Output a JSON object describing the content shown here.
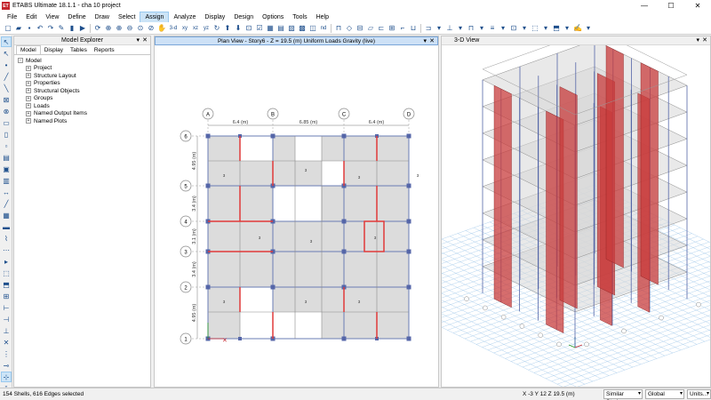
{
  "window": {
    "title": "ETABS Ultimate 18.1.1 - cha 10 project",
    "app_icon_text": "ET",
    "minimize": "—",
    "maximize": "☐",
    "close": "✕"
  },
  "menu": [
    "File",
    "Edit",
    "View",
    "Define",
    "Draw",
    "Select",
    "Assign",
    "Analyze",
    "Display",
    "Design",
    "Options",
    "Tools",
    "Help"
  ],
  "menu_active": "Assign",
  "toolbar": {
    "threed_label": "3-d",
    "xy_label": "xy",
    "xz_label": "xz",
    "yz_label": "yz",
    "nd_label": "nd"
  },
  "explorer": {
    "title": "Model Explorer",
    "tabs": [
      "Model",
      "Display",
      "Tables",
      "Reports"
    ],
    "active_tab": "Model",
    "root": "Model",
    "items": [
      "Project",
      "Structure Layout",
      "Properties",
      "Structural Objects",
      "Groups",
      "Loads",
      "Named Output Items",
      "Named Plots"
    ],
    "collapse_glyph": "−",
    "expand_glyph": "+"
  },
  "plan_view": {
    "title": "Plan View - Story6 - Z = 19.5 (m)  Uniform Loads Gravity  (live)",
    "grid_x": [
      "A",
      "B",
      "C",
      "D"
    ],
    "grid_y": [
      "6",
      "5",
      "4",
      "3",
      "2",
      "1"
    ],
    "x_dims": [
      "6.4 (m)",
      "6.85 (m)",
      "6.4 (m)"
    ],
    "y_dims": [
      "4.95 (m)",
      "3.4 (m)",
      "3.1 (m)",
      "3.4 (m)",
      "4.95 (m)"
    ],
    "load_label": "3"
  },
  "view3d": {
    "title": "3-D View"
  },
  "status": {
    "selection": "154 Shells, 616 Edges selected",
    "coords": "X -3  Y 12  Z 19.5 (m)",
    "stories": "Similar Stories",
    "csys": "Global",
    "units": "Units..."
  },
  "colors": {
    "accent": "#c4262e",
    "slab": "#dcdcdc",
    "beam": "#6a7db5",
    "column": "#5566a8",
    "wall": "#e03a3a",
    "pier": "#c84a4a"
  }
}
